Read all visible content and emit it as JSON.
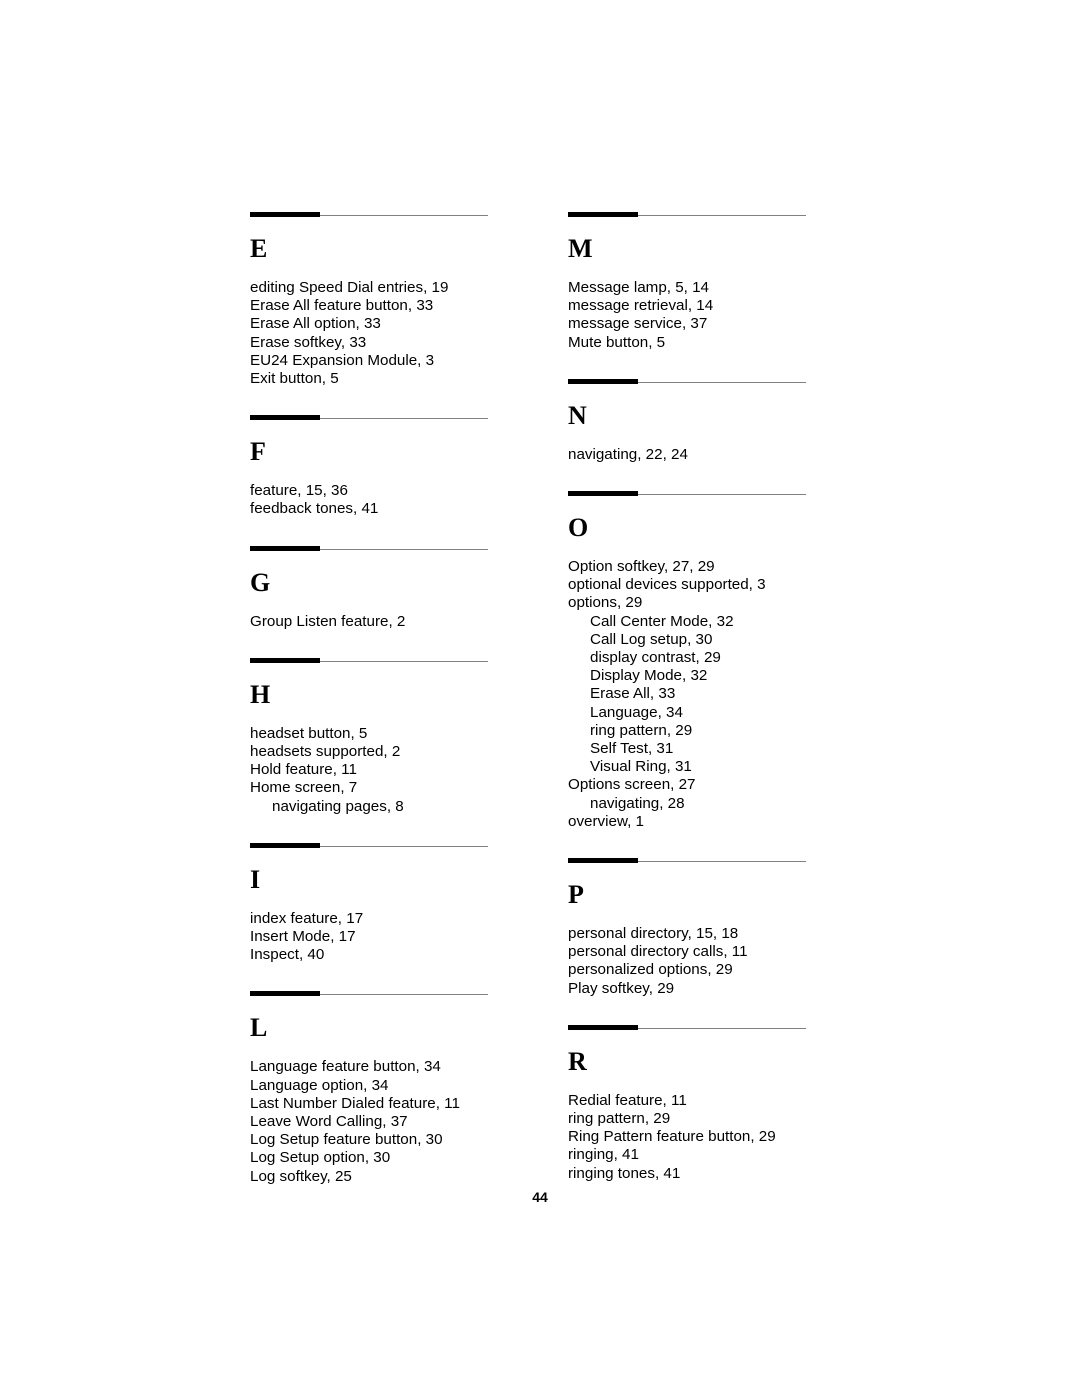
{
  "document": {
    "type": "index",
    "page_number": "44"
  },
  "columns": [
    {
      "name": "left-column",
      "sections": [
        {
          "letter": "E",
          "entries": [
            {
              "text": "editing Speed Dial entries, 19",
              "level": 0
            },
            {
              "text": "Erase All feature button, 33",
              "level": 0
            },
            {
              "text": "Erase All option, 33",
              "level": 0
            },
            {
              "text": "Erase softkey, 33",
              "level": 0
            },
            {
              "text": "EU24 Expansion Module, 3",
              "level": 0
            },
            {
              "text": "Exit button, 5",
              "level": 0
            }
          ]
        },
        {
          "letter": "F",
          "entries": [
            {
              "text": "feature, 15, 36",
              "level": 0
            },
            {
              "text": "feedback tones, 41",
              "level": 0
            }
          ]
        },
        {
          "letter": "G",
          "entries": [
            {
              "text": "Group Listen feature, 2",
              "level": 0
            }
          ]
        },
        {
          "letter": "H",
          "entries": [
            {
              "text": "headset button, 5",
              "level": 0
            },
            {
              "text": "headsets supported, 2",
              "level": 0
            },
            {
              "text": "Hold feature, 11",
              "level": 0
            },
            {
              "text": "Home screen, 7",
              "level": 0
            },
            {
              "text": "navigating pages, 8",
              "level": 1
            }
          ]
        },
        {
          "letter": "I",
          "entries": [
            {
              "text": "index feature, 17",
              "level": 0
            },
            {
              "text": "Insert Mode, 17",
              "level": 0
            },
            {
              "text": "Inspect, 40",
              "level": 0
            }
          ]
        },
        {
          "letter": "L",
          "entries": [
            {
              "text": "Language feature button, 34",
              "level": 0
            },
            {
              "text": "Language option, 34",
              "level": 0
            },
            {
              "text": "Last Number Dialed feature, 11",
              "level": 0
            },
            {
              "text": "Leave Word Calling, 37",
              "level": 0
            },
            {
              "text": "Log Setup feature button, 30",
              "level": 0
            },
            {
              "text": "Log Setup option, 30",
              "level": 0
            },
            {
              "text": "Log softkey, 25",
              "level": 0
            }
          ]
        }
      ]
    },
    {
      "name": "right-column",
      "sections": [
        {
          "letter": "M",
          "entries": [
            {
              "text": "Message lamp, 5, 14",
              "level": 0
            },
            {
              "text": "message retrieval, 14",
              "level": 0
            },
            {
              "text": "message service, 37",
              "level": 0
            },
            {
              "text": "Mute button, 5",
              "level": 0
            }
          ]
        },
        {
          "letter": "N",
          "entries": [
            {
              "text": "navigating, 22, 24",
              "level": 0
            }
          ]
        },
        {
          "letter": "O",
          "entries": [
            {
              "text": "Option softkey, 27, 29",
              "level": 0
            },
            {
              "text": "optional devices supported, 3",
              "level": 0
            },
            {
              "text": "options, 29",
              "level": 0
            },
            {
              "text": "Call Center Mode, 32",
              "level": 1
            },
            {
              "text": "Call Log setup, 30",
              "level": 1
            },
            {
              "text": "display contrast, 29",
              "level": 1
            },
            {
              "text": "Display Mode, 32",
              "level": 1
            },
            {
              "text": "Erase All, 33",
              "level": 1
            },
            {
              "text": "Language, 34",
              "level": 1
            },
            {
              "text": "ring pattern, 29",
              "level": 1
            },
            {
              "text": "Self Test, 31",
              "level": 1
            },
            {
              "text": "Visual Ring, 31",
              "level": 1
            },
            {
              "text": "Options screen, 27",
              "level": 0
            },
            {
              "text": "navigating, 28",
              "level": 1
            },
            {
              "text": "overview, 1",
              "level": 0
            }
          ]
        },
        {
          "letter": "P",
          "entries": [
            {
              "text": "personal directory, 15, 18",
              "level": 0
            },
            {
              "text": "personal directory calls, 11",
              "level": 0
            },
            {
              "text": "personalized options, 29",
              "level": 0
            },
            {
              "text": "Play softkey, 29",
              "level": 0
            }
          ]
        },
        {
          "letter": "R",
          "entries": [
            {
              "text": "Redial feature, 11",
              "level": 0
            },
            {
              "text": "ring pattern, 29",
              "level": 0
            },
            {
              "text": "Ring Pattern feature button, 29",
              "level": 0
            },
            {
              "text": "ringing, 41",
              "level": 0
            },
            {
              "text": "ringing tones, 41",
              "level": 0
            }
          ]
        }
      ]
    }
  ]
}
